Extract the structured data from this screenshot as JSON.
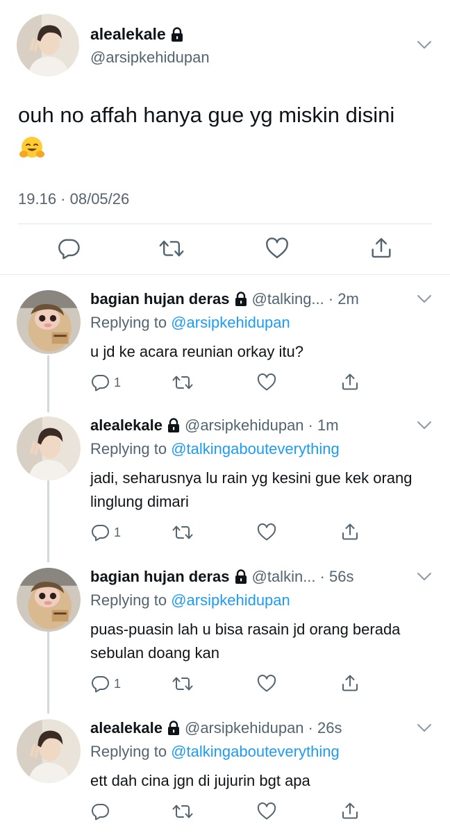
{
  "main_tweet": {
    "display_name": "alealekale",
    "handle": "@arsipkehidupan",
    "text": "ouh no affah hanya gue yg miskin disini",
    "emoji": "🤗",
    "timestamp": "19.16 · 08/05/26",
    "icons": [
      "comment-icon",
      "retweet-icon",
      "like-icon",
      "share-icon"
    ]
  },
  "replies": [
    {
      "display_name": "bagian hujan deras",
      "handle": "@talking...",
      "time": "· 2m",
      "replying_prefix": "Replying to",
      "replying_to": "@arsipkehidupan",
      "text": "u jd ke acara reunian orkay itu?",
      "reply_count": "1"
    },
    {
      "display_name": "alealekale",
      "handle": "@arsipkehidupan",
      "time": "· 1m",
      "replying_prefix": "Replying to",
      "replying_to": "@talkingabouteverything",
      "text": "jadi, seharusnya lu rain yg kesini gue kek orang linglung dimari",
      "reply_count": "1"
    },
    {
      "display_name": "bagian hujan deras",
      "handle": "@talkin...",
      "time": "· 56s",
      "replying_prefix": "Replying to",
      "replying_to": "@arsipkehidupan",
      "text": "puas-puasin lah u bisa rasain jd orang berada sebulan doang kan",
      "reply_count": "1"
    },
    {
      "display_name": "alealekale",
      "handle": "@arsipkehidupan",
      "time": "· 26s",
      "replying_prefix": "Replying to",
      "replying_to": "@talkingabouteverything",
      "text": "ett dah cina jgn di jujurin bgt apa",
      "reply_count": ""
    }
  ],
  "colors": {
    "link": "#1d9bf0",
    "secondary_text": "#536471",
    "thread_line": "#cfd9de",
    "icon": "#536471"
  }
}
